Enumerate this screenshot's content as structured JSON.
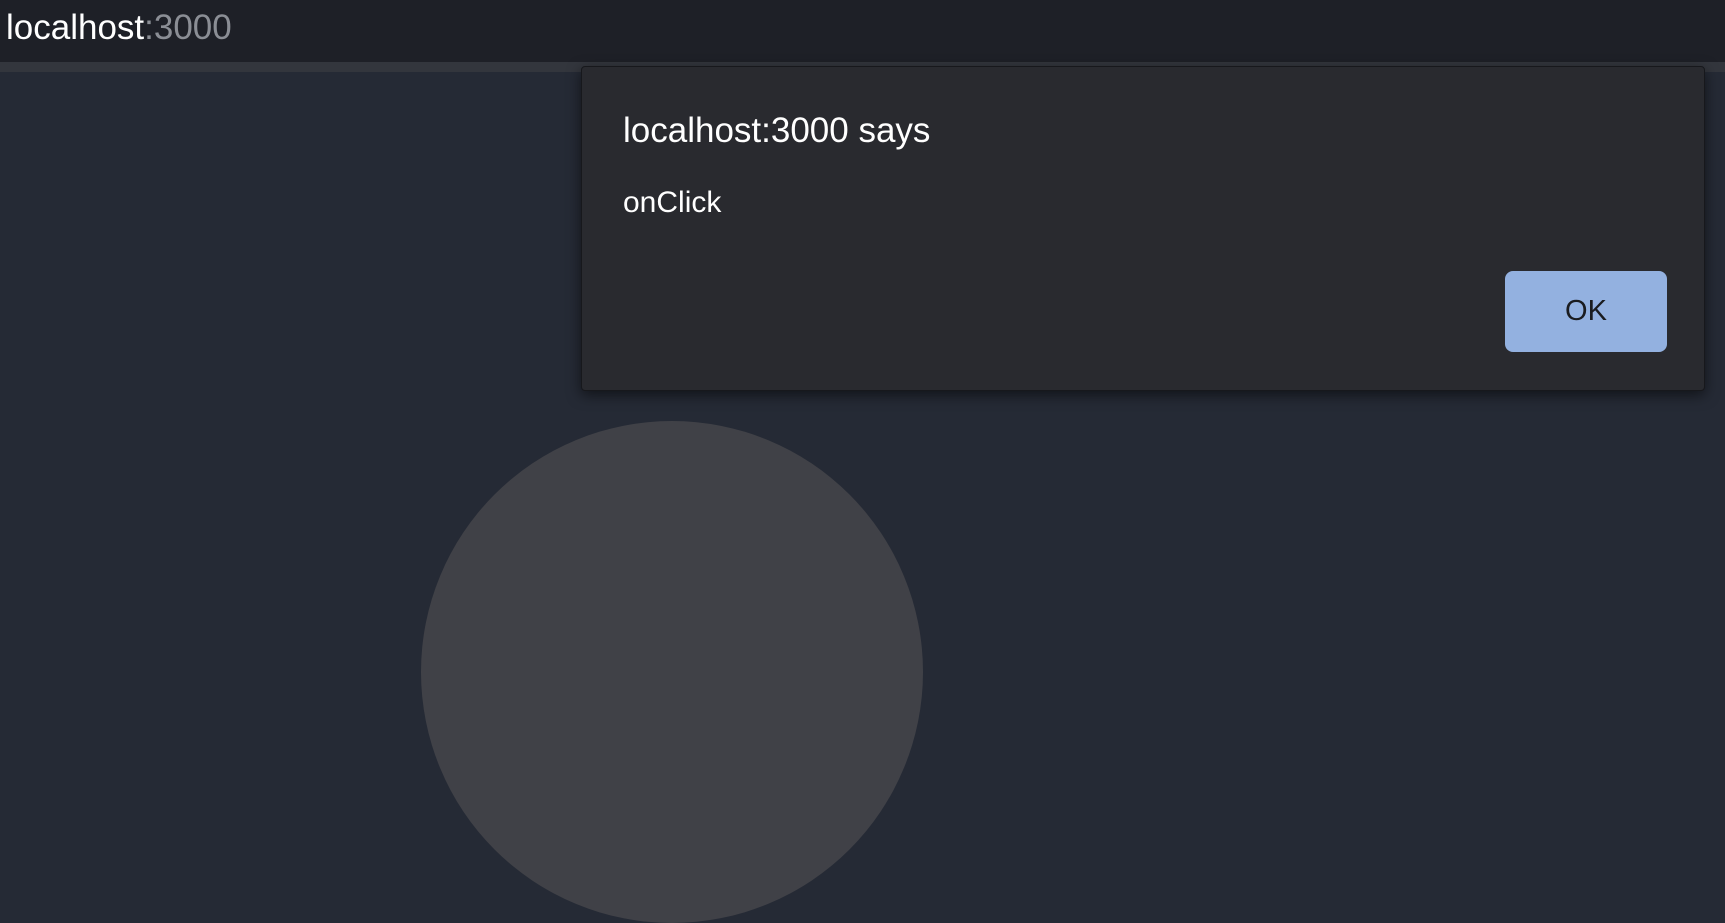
{
  "browser": {
    "url_host": "localhost",
    "url_port": ":3000"
  },
  "dialog": {
    "title": "localhost:3000 says",
    "message": "onClick",
    "ok_label": "OK"
  },
  "colors": {
    "page_background": "#252a35",
    "dialog_background": "#292a2f",
    "button_background": "#93b1e0",
    "circle": "#404147"
  }
}
